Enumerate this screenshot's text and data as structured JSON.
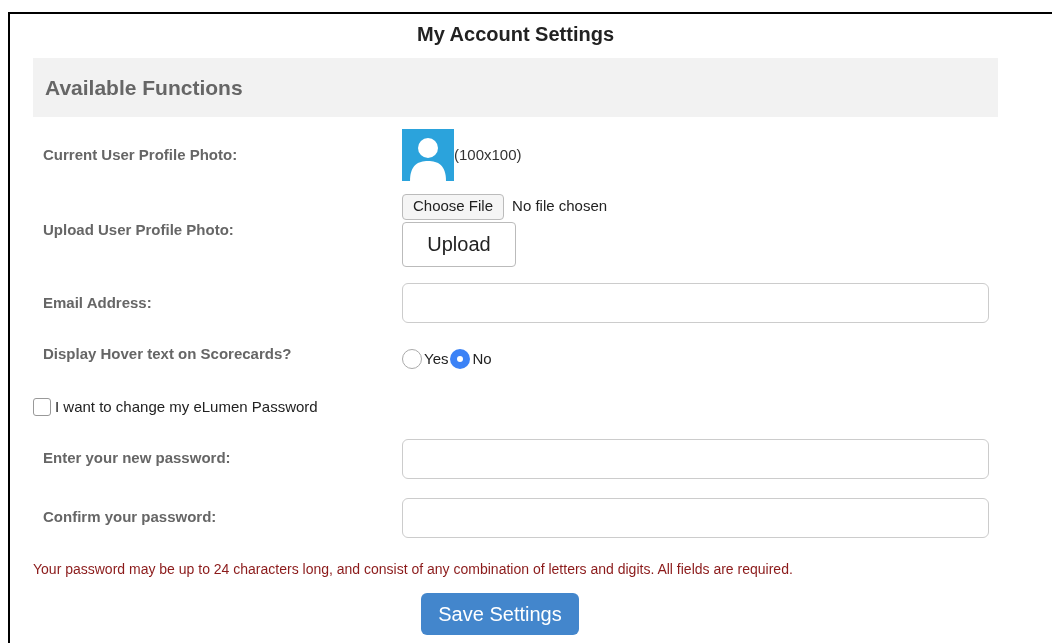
{
  "title": "My Account Settings",
  "section": "Available Functions",
  "photo": {
    "label": "Current User Profile Photo:",
    "size": "(100x100)"
  },
  "upload": {
    "label": "Upload User Profile Photo:",
    "choose": "Choose File",
    "status": "No file chosen",
    "button": "Upload"
  },
  "email": {
    "label": "Email Address:"
  },
  "hover": {
    "label": "Display Hover text on Scorecards?",
    "options": [
      {
        "label": "Yes",
        "selected": false
      },
      {
        "label": "No",
        "selected": true
      }
    ]
  },
  "change_password": {
    "label": "I want to change my eLumen Password",
    "checked": false
  },
  "passwords": [
    {
      "label": "Enter your new password:"
    },
    {
      "label": "Confirm your password:"
    }
  ],
  "note": "Your password may be up to 24 characters long, and consist of any combination of letters and digits. All fields are required.",
  "save": "Save Settings"
}
